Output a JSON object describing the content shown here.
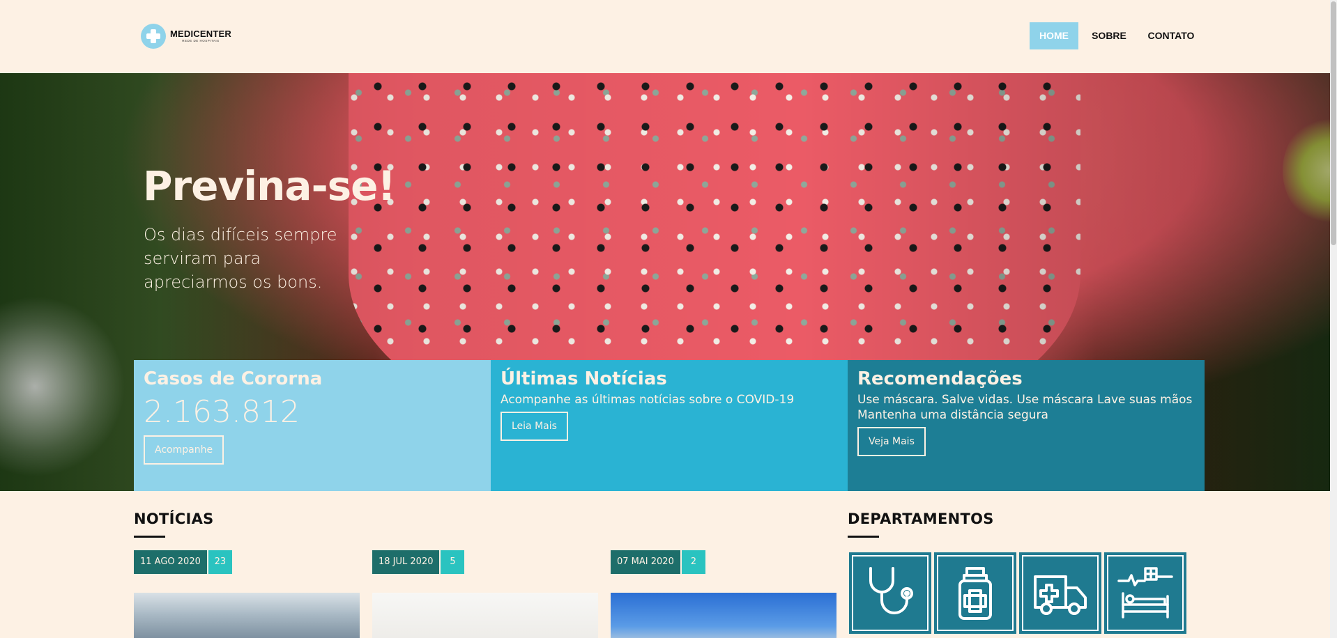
{
  "header": {
    "logo_name": "MEDICENTER",
    "logo_sub": "REDE DE HOSPITAIS",
    "nav": [
      {
        "label": "HOME",
        "active": true
      },
      {
        "label": "SOBRE",
        "active": false
      },
      {
        "label": "CONTATO",
        "active": false
      }
    ]
  },
  "hero": {
    "title": "Previna-se!",
    "subtitle": "Os dias difíceis sempre serviram para apreciarmos os bons."
  },
  "cards": [
    {
      "title": "Casos de Cororna",
      "number": "2.163.812",
      "button": "Acompanhe"
    },
    {
      "title": "Últimas Notícias",
      "text": "Acompanhe as últimas notícias sobre o COVID-19",
      "button": "Leia Mais"
    },
    {
      "title": "Recomendações",
      "text": "Use máscara. Salve vidas. Use máscara Lave suas mãos Mantenha uma distância segura",
      "button": "Veja Mais"
    }
  ],
  "news": {
    "title": "NOTÍCIAS",
    "items": [
      {
        "date": "11 AGO 2020",
        "count": "23"
      },
      {
        "date": "18 JUL 2020",
        "count": "5"
      },
      {
        "date": "07 MAI 2020",
        "count": "2"
      }
    ]
  },
  "departments": {
    "title": "DEPARTAMENTOS",
    "icons": [
      "stethoscope-icon",
      "medicine-bottle-icon",
      "ambulance-icon",
      "hospital-bed-icon"
    ]
  },
  "colors": {
    "background": "#fdf1e4",
    "accent_light": "#8fd3ea",
    "accent_mid": "#2ab3d3",
    "accent_dark": "#1d7e95",
    "date_badge": "#1d6e6a",
    "count_badge": "#2ac3c0"
  }
}
